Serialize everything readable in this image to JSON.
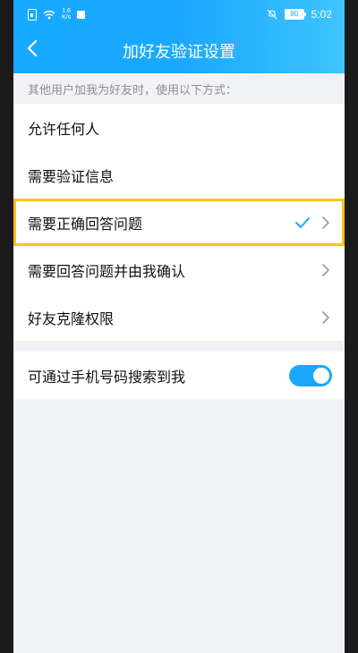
{
  "status_bar": {
    "speed_top": "1.6",
    "speed_bottom": "K/s",
    "battery": "90",
    "time": "5:02"
  },
  "header": {
    "title": "加好友验证设置"
  },
  "hint": "其他用户加我为好友时，使用以下方式：",
  "options": [
    {
      "label": "允许任何人",
      "selected": false,
      "has_chevron": false
    },
    {
      "label": "需要验证信息",
      "selected": false,
      "has_chevron": false
    },
    {
      "label": "需要正确回答问题",
      "selected": true,
      "has_chevron": true
    },
    {
      "label": "需要回答问题并由我确认",
      "selected": false,
      "has_chevron": true
    },
    {
      "label": "好友克隆权限",
      "selected": false,
      "has_chevron": true
    }
  ],
  "phone_search": {
    "label": "可通过手机号码搜索到我",
    "enabled": true
  },
  "colors": {
    "accent": "#1aa8ff",
    "highlight": "#ffc21a"
  }
}
